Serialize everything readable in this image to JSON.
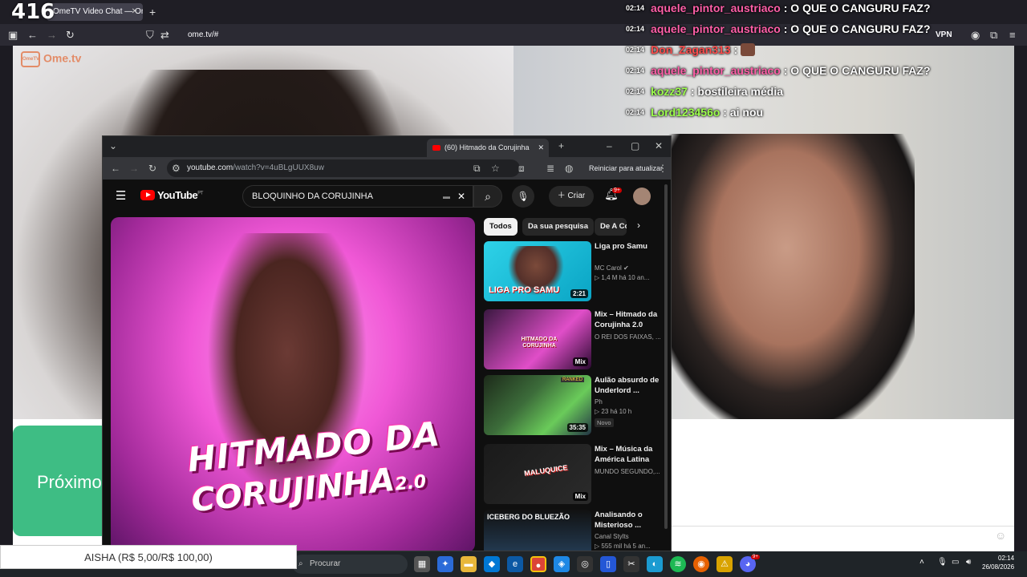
{
  "overlay": {
    "counter": "416"
  },
  "firefox": {
    "tab_title": "OmeTV Video Chat — Ome",
    "url": "ome.tv/#",
    "vpn_label": "VPN"
  },
  "ometv": {
    "logo": "Ome.tv",
    "logo_small": "OmeTV",
    "next_button": "Próximo"
  },
  "chat": [
    {
      "time": "02:14",
      "user": "aquele_pintor_austriaco",
      "text": ": O QUE O CANGURU FAZ?",
      "color": "pink"
    },
    {
      "time": "02:14",
      "user": "aquele_pintor_austriaco",
      "text": ": O QUE O CANGURU FAZ?",
      "color": "pink"
    },
    {
      "time": "02:14",
      "user": "Don_Zagan313",
      "text": ":",
      "color": "red"
    },
    {
      "time": "02:14",
      "user": "aquele_pintor_austriaco",
      "text": ": O QUE O CANGURU FAZ?",
      "color": "pink"
    },
    {
      "time": "02:14",
      "user": "kozz37",
      "text": ": bostileira média",
      "color": "green"
    },
    {
      "time": "02:14",
      "user": "Lord123456o",
      "text": ": ai nou",
      "color": "green"
    }
  ],
  "chrome": {
    "tab_title": "(60) Hitmado da Corujinha",
    "url_host": "youtube.com",
    "url_path": "/watch?v=4uBLgUUX8uw",
    "update_label": "Reiniciar para atualizar"
  },
  "youtube": {
    "logo": "YouTube",
    "logo_region": "PT",
    "search_value": "BLOQUINHO DA CORUJINHA",
    "create_label": "Criar",
    "notif_count": "9+",
    "video_title_line1": "HITMADO DA",
    "video_title_line2": "CORUJINHA",
    "video_title_version": "2.0",
    "chips": [
      "Todos",
      "Da sua pesquisa",
      "De A Co"
    ],
    "recs": [
      {
        "title": "Liga pro Samu",
        "channel": "MC Carol",
        "meta": "1,4 M  há 10 an...",
        "duration": "2:21",
        "thumb_text": "LIGA PRO SAMU"
      },
      {
        "title": "Mix – Hitmado da Corujinha 2.0",
        "channel": "O REI DOS FAIXAS, ...",
        "meta": "",
        "duration": "Mix",
        "thumb_text": "HITMADO DA CORUJINHA"
      },
      {
        "title": "Aulão absurdo de Underlord ...",
        "channel": "Ph",
        "meta": "23  há 10 h",
        "duration": "35:35",
        "badge": "Novo",
        "thumb_text": "RANKED"
      },
      {
        "title": "Mix – Música da América Latina",
        "channel": "MUNDO SEGUNDO,...",
        "meta": "",
        "duration": "Mix",
        "thumb_text": "MALUQUICE"
      },
      {
        "title": "Analisando o Misterioso ...",
        "channel": "Canal Stylts",
        "meta": "555 mil  há 5 an...",
        "duration": "",
        "thumb_text": "ICEBERG DO BLUEZÃO"
      }
    ]
  },
  "taskbar": {
    "search_placeholder": "Procurar",
    "time": "02:14",
    "date": "26/08/2026",
    "discord_badge": "9+"
  },
  "donation": {
    "text": "AISHA (R$ 5,00/R$ 100,00)"
  }
}
